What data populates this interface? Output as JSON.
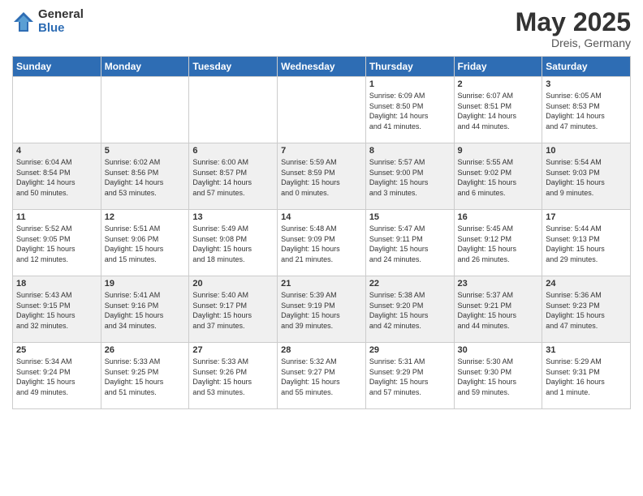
{
  "logo": {
    "general": "General",
    "blue": "Blue"
  },
  "title": "May 2025",
  "location": "Dreis, Germany",
  "days_header": [
    "Sunday",
    "Monday",
    "Tuesday",
    "Wednesday",
    "Thursday",
    "Friday",
    "Saturday"
  ],
  "weeks": [
    [
      {
        "day": "",
        "info": ""
      },
      {
        "day": "",
        "info": ""
      },
      {
        "day": "",
        "info": ""
      },
      {
        "day": "",
        "info": ""
      },
      {
        "day": "1",
        "info": "Sunrise: 6:09 AM\nSunset: 8:50 PM\nDaylight: 14 hours\nand 41 minutes."
      },
      {
        "day": "2",
        "info": "Sunrise: 6:07 AM\nSunset: 8:51 PM\nDaylight: 14 hours\nand 44 minutes."
      },
      {
        "day": "3",
        "info": "Sunrise: 6:05 AM\nSunset: 8:53 PM\nDaylight: 14 hours\nand 47 minutes."
      }
    ],
    [
      {
        "day": "4",
        "info": "Sunrise: 6:04 AM\nSunset: 8:54 PM\nDaylight: 14 hours\nand 50 minutes."
      },
      {
        "day": "5",
        "info": "Sunrise: 6:02 AM\nSunset: 8:56 PM\nDaylight: 14 hours\nand 53 minutes."
      },
      {
        "day": "6",
        "info": "Sunrise: 6:00 AM\nSunset: 8:57 PM\nDaylight: 14 hours\nand 57 minutes."
      },
      {
        "day": "7",
        "info": "Sunrise: 5:59 AM\nSunset: 8:59 PM\nDaylight: 15 hours\nand 0 minutes."
      },
      {
        "day": "8",
        "info": "Sunrise: 5:57 AM\nSunset: 9:00 PM\nDaylight: 15 hours\nand 3 minutes."
      },
      {
        "day": "9",
        "info": "Sunrise: 5:55 AM\nSunset: 9:02 PM\nDaylight: 15 hours\nand 6 minutes."
      },
      {
        "day": "10",
        "info": "Sunrise: 5:54 AM\nSunset: 9:03 PM\nDaylight: 15 hours\nand 9 minutes."
      }
    ],
    [
      {
        "day": "11",
        "info": "Sunrise: 5:52 AM\nSunset: 9:05 PM\nDaylight: 15 hours\nand 12 minutes."
      },
      {
        "day": "12",
        "info": "Sunrise: 5:51 AM\nSunset: 9:06 PM\nDaylight: 15 hours\nand 15 minutes."
      },
      {
        "day": "13",
        "info": "Sunrise: 5:49 AM\nSunset: 9:08 PM\nDaylight: 15 hours\nand 18 minutes."
      },
      {
        "day": "14",
        "info": "Sunrise: 5:48 AM\nSunset: 9:09 PM\nDaylight: 15 hours\nand 21 minutes."
      },
      {
        "day": "15",
        "info": "Sunrise: 5:47 AM\nSunset: 9:11 PM\nDaylight: 15 hours\nand 24 minutes."
      },
      {
        "day": "16",
        "info": "Sunrise: 5:45 AM\nSunset: 9:12 PM\nDaylight: 15 hours\nand 26 minutes."
      },
      {
        "day": "17",
        "info": "Sunrise: 5:44 AM\nSunset: 9:13 PM\nDaylight: 15 hours\nand 29 minutes."
      }
    ],
    [
      {
        "day": "18",
        "info": "Sunrise: 5:43 AM\nSunset: 9:15 PM\nDaylight: 15 hours\nand 32 minutes."
      },
      {
        "day": "19",
        "info": "Sunrise: 5:41 AM\nSunset: 9:16 PM\nDaylight: 15 hours\nand 34 minutes."
      },
      {
        "day": "20",
        "info": "Sunrise: 5:40 AM\nSunset: 9:17 PM\nDaylight: 15 hours\nand 37 minutes."
      },
      {
        "day": "21",
        "info": "Sunrise: 5:39 AM\nSunset: 9:19 PM\nDaylight: 15 hours\nand 39 minutes."
      },
      {
        "day": "22",
        "info": "Sunrise: 5:38 AM\nSunset: 9:20 PM\nDaylight: 15 hours\nand 42 minutes."
      },
      {
        "day": "23",
        "info": "Sunrise: 5:37 AM\nSunset: 9:21 PM\nDaylight: 15 hours\nand 44 minutes."
      },
      {
        "day": "24",
        "info": "Sunrise: 5:36 AM\nSunset: 9:23 PM\nDaylight: 15 hours\nand 47 minutes."
      }
    ],
    [
      {
        "day": "25",
        "info": "Sunrise: 5:34 AM\nSunset: 9:24 PM\nDaylight: 15 hours\nand 49 minutes."
      },
      {
        "day": "26",
        "info": "Sunrise: 5:33 AM\nSunset: 9:25 PM\nDaylight: 15 hours\nand 51 minutes."
      },
      {
        "day": "27",
        "info": "Sunrise: 5:33 AM\nSunset: 9:26 PM\nDaylight: 15 hours\nand 53 minutes."
      },
      {
        "day": "28",
        "info": "Sunrise: 5:32 AM\nSunset: 9:27 PM\nDaylight: 15 hours\nand 55 minutes."
      },
      {
        "day": "29",
        "info": "Sunrise: 5:31 AM\nSunset: 9:29 PM\nDaylight: 15 hours\nand 57 minutes."
      },
      {
        "day": "30",
        "info": "Sunrise: 5:30 AM\nSunset: 9:30 PM\nDaylight: 15 hours\nand 59 minutes."
      },
      {
        "day": "31",
        "info": "Sunrise: 5:29 AM\nSunset: 9:31 PM\nDaylight: 16 hours\nand 1 minute."
      }
    ]
  ]
}
